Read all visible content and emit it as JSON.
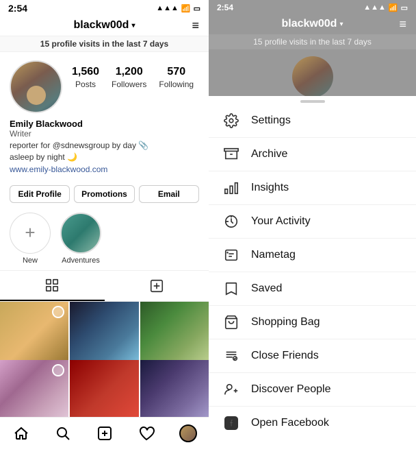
{
  "app": {
    "time": "2:54",
    "username": "blackw00d",
    "visits_count": "15",
    "visits_text": "profile visits in the last 7 days"
  },
  "profile": {
    "name": "Emily Blackwood",
    "title": "Writer",
    "bio_line1": "reporter for @sdnewsgroup by day 📎",
    "bio_line2": "asleep by night 🌙",
    "website": "www.emily-blackwood.com",
    "stats": {
      "posts": {
        "count": "1,560",
        "label": "Posts"
      },
      "followers": {
        "count": "1,200",
        "label": "Followers"
      },
      "following": {
        "count": "570",
        "label": "Following"
      }
    }
  },
  "buttons": {
    "edit_profile": "Edit Profile",
    "promotions": "Promotions",
    "email": "Email"
  },
  "stories": [
    {
      "type": "new",
      "label": "New"
    },
    {
      "type": "thumb",
      "label": "Adventures"
    }
  ],
  "bottom_nav": [
    {
      "name": "home",
      "icon": "⌂"
    },
    {
      "name": "search",
      "icon": "🔍"
    },
    {
      "name": "add",
      "icon": "➕"
    },
    {
      "name": "heart",
      "icon": "♡"
    },
    {
      "name": "profile",
      "icon": "avatar"
    }
  ],
  "menu": {
    "items": [
      {
        "id": "settings",
        "label": "Settings",
        "icon": "gear"
      },
      {
        "id": "archive",
        "label": "Archive",
        "icon": "clock-back"
      },
      {
        "id": "insights",
        "label": "Insights",
        "icon": "bar-chart"
      },
      {
        "id": "your-activity",
        "label": "Your Activity",
        "icon": "activity"
      },
      {
        "id": "nametag",
        "label": "Nametag",
        "icon": "nametag"
      },
      {
        "id": "saved",
        "label": "Saved",
        "icon": "bookmark"
      },
      {
        "id": "shopping-bag",
        "label": "Shopping Bag",
        "icon": "bag"
      },
      {
        "id": "close-friends",
        "label": "Close Friends",
        "icon": "list"
      },
      {
        "id": "discover-people",
        "label": "Discover People",
        "icon": "add-person"
      },
      {
        "id": "open-facebook",
        "label": "Open Facebook",
        "icon": "facebook"
      }
    ]
  }
}
